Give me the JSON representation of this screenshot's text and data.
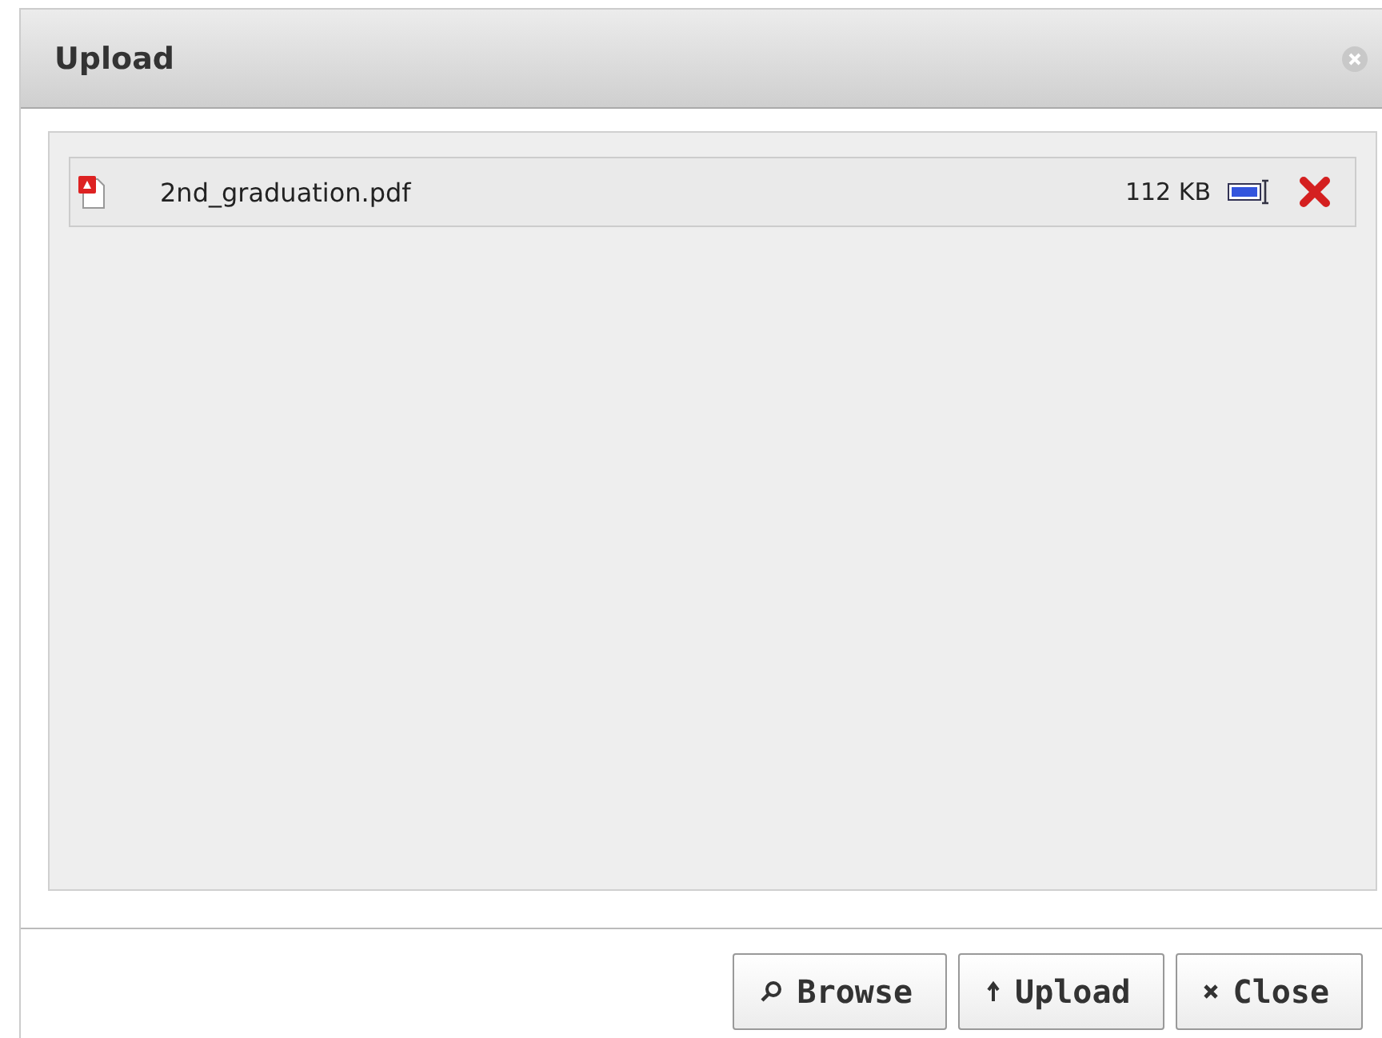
{
  "window": {
    "title": "Upload"
  },
  "files": [
    {
      "name": "2nd_graduation.pdf",
      "size": "112 KB"
    }
  ],
  "buttons": [
    {
      "label": "Browse",
      "kind": "search"
    },
    {
      "label": "Upload",
      "kind": "up"
    },
    {
      "label": "Close",
      "kind": "close"
    }
  ]
}
